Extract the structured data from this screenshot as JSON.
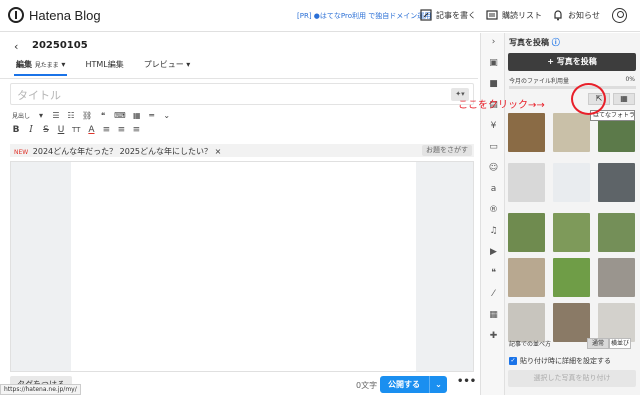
{
  "header": {
    "logo_text": "Hatena Blog",
    "pr_text": "[PR] ●はてなPro利用 で独自ドメイン運用",
    "write_label": "記事を書く",
    "reading_list_label": "購読リスト",
    "notifications_label": "お知らせ"
  },
  "editor": {
    "date_title": "20250105",
    "tabs": [
      {
        "label": "編集",
        "sublabel": "見たまま"
      },
      {
        "label": "HTML編集"
      },
      {
        "label": "プレビュー"
      }
    ],
    "title_placeholder": "タイトル",
    "heading_select": "見出し",
    "prompt_badge": "NEW",
    "prompt_text": "2024どんな年だった？ 2025どんな年にしたい？ ×",
    "prompt_browse": "お題をさがす",
    "tag_button": "タグをつける",
    "char_count": "0文字",
    "publish_label": "公開する",
    "more_label": "•••",
    "status_url": "https://hatena.ne.jp/my/"
  },
  "panel": {
    "heading": "写真を投稿",
    "upload_button": "+ 写真を投稿",
    "usage_label": "今月のファイル利用量",
    "usage_percent": "0%",
    "usage_fraction": 0.0,
    "tooltip": "はてなフォトライフで開く",
    "sort_label": "記事での並べ方",
    "sort_options": [
      "通常",
      "横並び"
    ],
    "checkbox_label": "貼り付け時に詳細を設定する",
    "paste_button": "選択した写真を貼り付け"
  },
  "annotation": {
    "text": "ここをクリック→→"
  },
  "colors": {
    "accent": "#1a8ff0",
    "annotation": "#e8202a",
    "dark_button": "#3d3d3d"
  }
}
